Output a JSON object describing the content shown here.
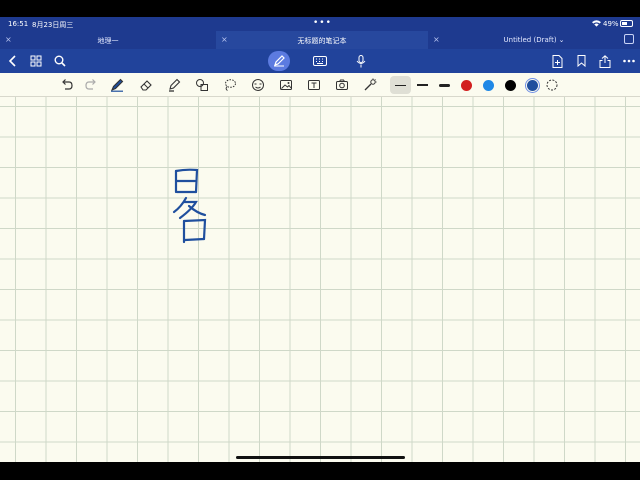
{
  "status": {
    "time": "16:51",
    "date": "8月23日周三",
    "battery_text": "49%",
    "battery_level": 0.49
  },
  "tabs": [
    {
      "label": "地理一",
      "active": false
    },
    {
      "label": "无标题的笔记本",
      "active": true
    },
    {
      "label": "Untitled (Draft)",
      "active": false,
      "caret": "⌄"
    }
  ],
  "icons": {
    "back": "chevron-left-icon",
    "grid": "grid-icon",
    "search": "search-icon",
    "pen_mode": "pen-icon",
    "keyboard": "keyboard-icon",
    "mic": "microphone-icon",
    "add_page": "add-page-icon",
    "bookmark": "bookmark-icon",
    "share": "share-icon",
    "more": "more-icon"
  },
  "tools": {
    "undo": "undo-icon",
    "redo": "redo-icon",
    "pen": "pen-icon",
    "eraser": "eraser-icon",
    "highlighter": "highlighter-icon",
    "shapes": "shapes-icon",
    "lasso": "lasso-icon",
    "sticker": "sticker-icon",
    "image": "image-icon",
    "text": "text-icon",
    "camera": "camera-icon",
    "laser": "laser-pointer-icon"
  },
  "colors": {
    "accent": "#1e3a8f",
    "ink": "#1f4f9e",
    "palette": [
      "#d21f1f",
      "#1f88e6",
      "#000000",
      "#1f4f9e"
    ]
  }
}
